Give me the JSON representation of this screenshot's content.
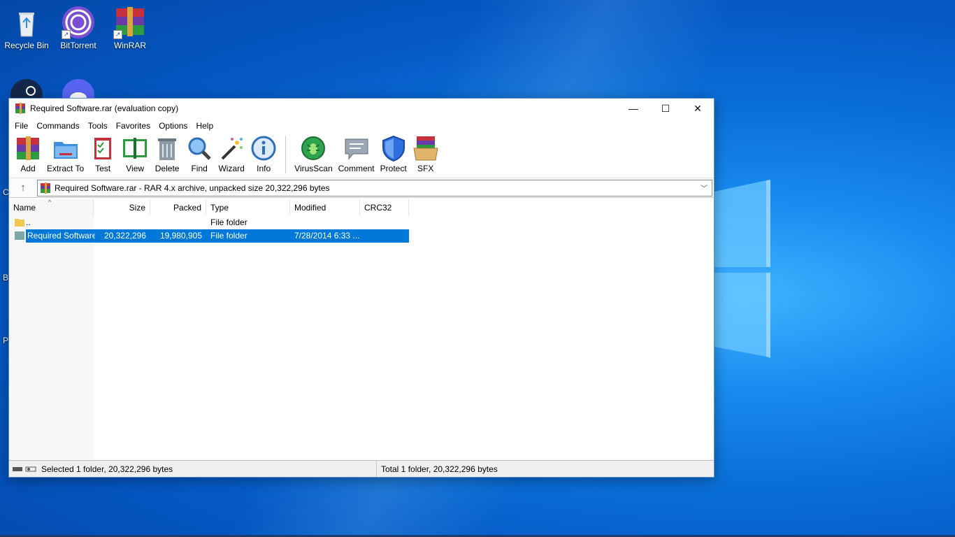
{
  "desktop": {
    "icons": [
      {
        "label": "Recycle Bin",
        "icon": "recycle-bin-icon"
      },
      {
        "label": "BitTorrent",
        "icon": "bittorrent-icon"
      },
      {
        "label": "WinRAR",
        "icon": "winrar-icon"
      },
      {
        "label": "",
        "icon": "steam-icon"
      },
      {
        "label": "",
        "icon": "discord-icon"
      }
    ],
    "edge_letters": [
      "C",
      "B",
      "P"
    ]
  },
  "window": {
    "title": "Required Software.rar (evaluation copy)",
    "controls": {
      "minimize": "—",
      "maximize": "☐",
      "close": "✕"
    }
  },
  "menu": [
    "File",
    "Commands",
    "Tools",
    "Favorites",
    "Options",
    "Help"
  ],
  "toolbar": {
    "buttons": [
      {
        "label": "Add",
        "icon": "add-archive-icon"
      },
      {
        "label": "Extract To",
        "icon": "extract-to-folder-icon"
      },
      {
        "label": "Test",
        "icon": "test-clipboard-icon"
      },
      {
        "label": "View",
        "icon": "view-book-icon"
      },
      {
        "label": "Delete",
        "icon": "delete-trash-icon"
      },
      {
        "label": "Find",
        "icon": "find-magnifier-icon"
      },
      {
        "label": "Wizard",
        "icon": "wizard-wand-icon"
      },
      {
        "label": "Info",
        "icon": "info-icon"
      },
      {
        "label": "VirusScan",
        "icon": "virus-scan-icon"
      },
      {
        "label": "Comment",
        "icon": "comment-icon"
      },
      {
        "label": "Protect",
        "icon": "protect-shield-icon"
      },
      {
        "label": "SFX",
        "icon": "sfx-box-icon"
      }
    ]
  },
  "address": {
    "text": "Required Software.rar - RAR 4.x archive, unpacked size 20,322,296 bytes"
  },
  "columns": [
    "Name",
    "Size",
    "Packed",
    "Type",
    "Modified",
    "CRC32"
  ],
  "files": [
    {
      "name": "..",
      "size": "",
      "packed": "",
      "type": "File folder",
      "modified": "",
      "crc": ""
    },
    {
      "name": "Required Software",
      "size": "20,322,296",
      "packed": "19,980,905",
      "type": "File folder",
      "modified": "7/28/2014 6:33 ...",
      "crc": ""
    }
  ],
  "status": {
    "left": "Selected 1 folder, 20,322,296 bytes",
    "right": "Total 1 folder, 20,322,296 bytes"
  },
  "colors": {
    "selection": "#0078d7",
    "wallpaper": "#0a6fd8"
  }
}
